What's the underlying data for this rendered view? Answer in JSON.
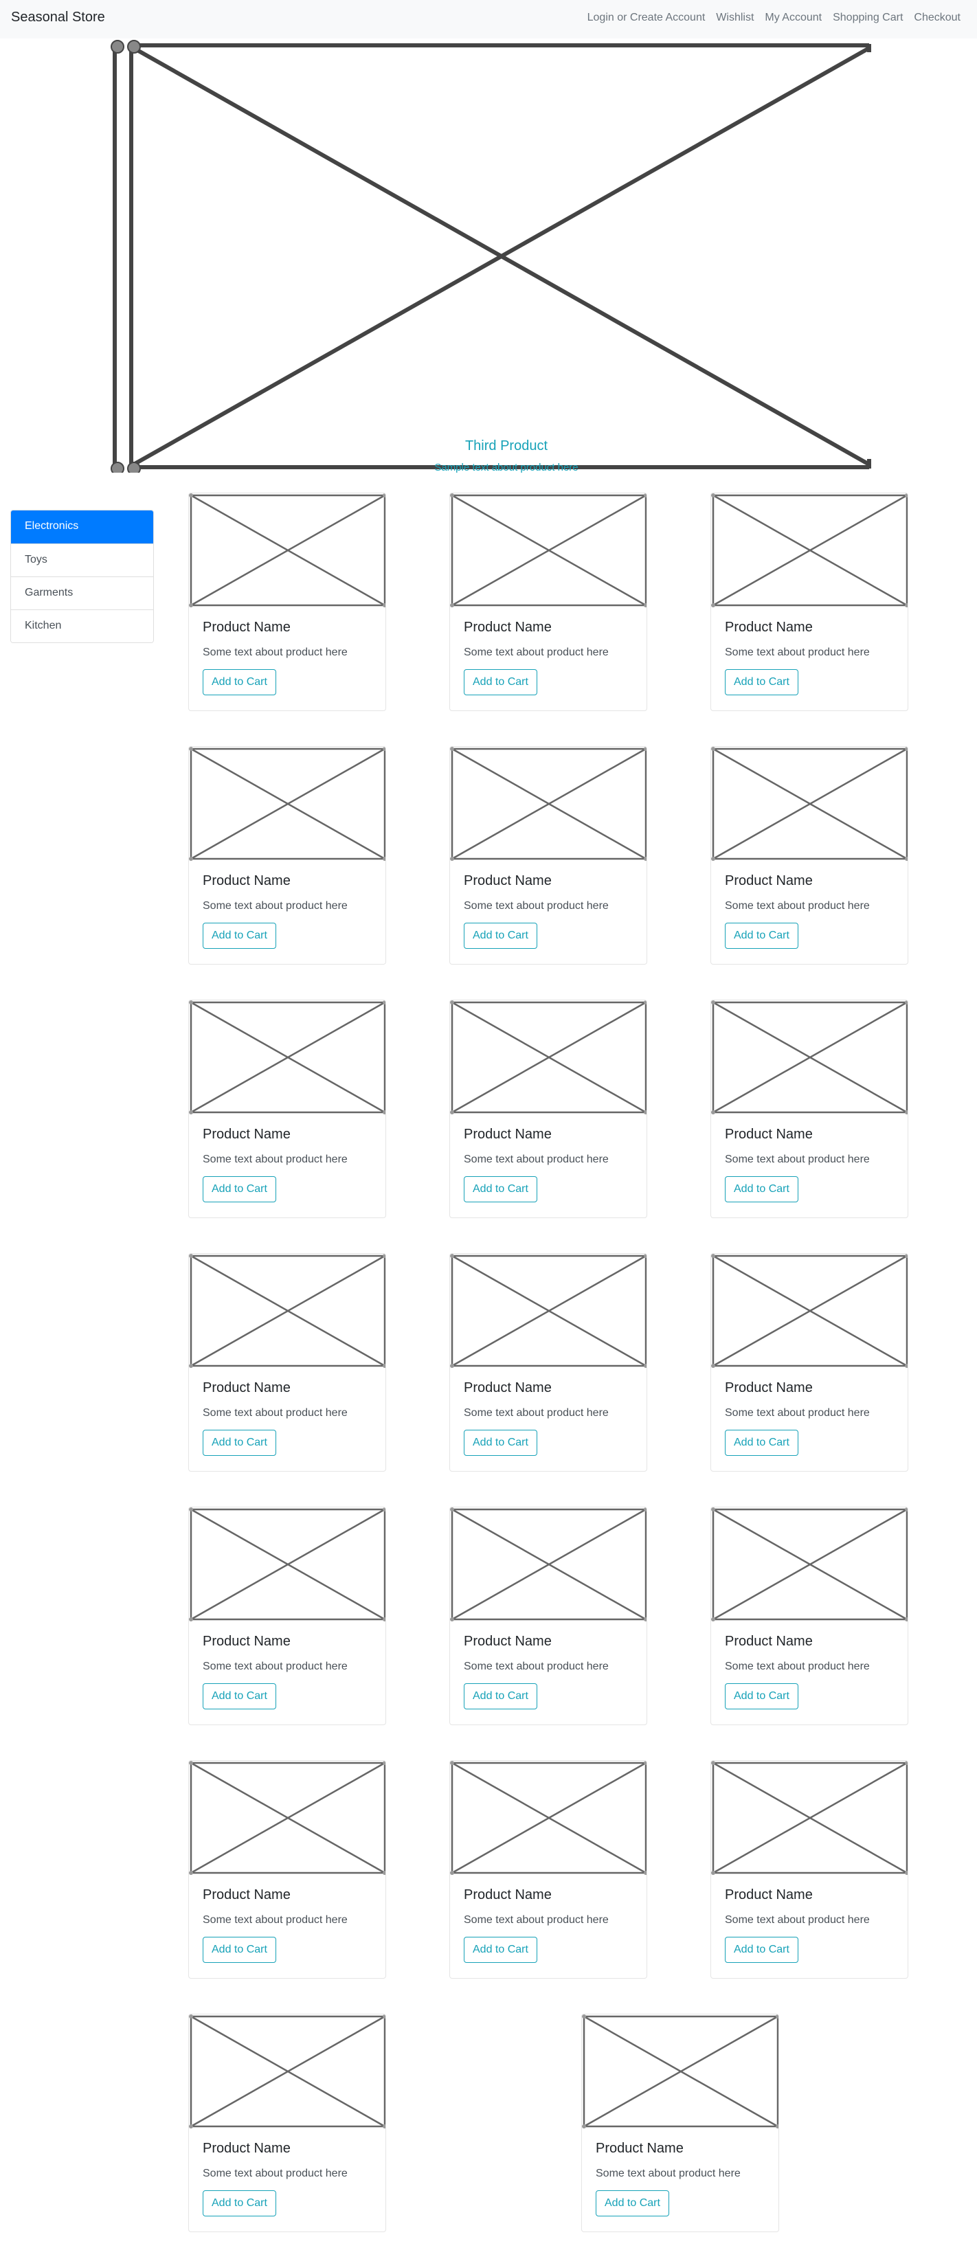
{
  "navbar": {
    "brand": "Seasonal Store",
    "links": [
      "Login or Create Account",
      "Wishlist",
      "My Account",
      "Shopping Cart",
      "Checkout"
    ]
  },
  "carousel": {
    "caption_title": "Third Product",
    "caption_text": "Sample text about product here"
  },
  "categories": {
    "active_index": 0,
    "items": [
      "Electronics",
      "Toys",
      "Garments",
      "Kitchen"
    ]
  },
  "products": [
    {
      "name": "Product Name",
      "text": "Some text about product here",
      "button": "Add to Cart"
    },
    {
      "name": "Product Name",
      "text": "Some text about product here",
      "button": "Add to Cart"
    },
    {
      "name": "Product Name",
      "text": "Some text about product here",
      "button": "Add to Cart"
    },
    {
      "name": "Product Name",
      "text": "Some text about product here",
      "button": "Add to Cart"
    },
    {
      "name": "Product Name",
      "text": "Some text about product here",
      "button": "Add to Cart"
    },
    {
      "name": "Product Name",
      "text": "Some text about product here",
      "button": "Add to Cart"
    },
    {
      "name": "Product Name",
      "text": "Some text about product here",
      "button": "Add to Cart"
    },
    {
      "name": "Product Name",
      "text": "Some text about product here",
      "button": "Add to Cart"
    },
    {
      "name": "Product Name",
      "text": "Some text about product here",
      "button": "Add to Cart"
    },
    {
      "name": "Product Name",
      "text": "Some text about product here",
      "button": "Add to Cart"
    },
    {
      "name": "Product Name",
      "text": "Some text about product here",
      "button": "Add to Cart"
    },
    {
      "name": "Product Name",
      "text": "Some text about product here",
      "button": "Add to Cart"
    },
    {
      "name": "Product Name",
      "text": "Some text about product here",
      "button": "Add to Cart"
    },
    {
      "name": "Product Name",
      "text": "Some text about product here",
      "button": "Add to Cart"
    },
    {
      "name": "Product Name",
      "text": "Some text about product here",
      "button": "Add to Cart"
    },
    {
      "name": "Product Name",
      "text": "Some text about product here",
      "button": "Add to Cart"
    },
    {
      "name": "Product Name",
      "text": "Some text about product here",
      "button": "Add to Cart"
    },
    {
      "name": "Product Name",
      "text": "Some text about product here",
      "button": "Add to Cart"
    },
    {
      "name": "Product Name",
      "text": "Some text about product here",
      "button": "Add to Cart"
    },
    {
      "name": "Product Name",
      "text": "Some text about product here",
      "button": "Add to Cart"
    }
  ],
  "colors": {
    "accent": "#17a2b8",
    "active": "#007bff",
    "navbar_bg": "#f8f9fa"
  }
}
